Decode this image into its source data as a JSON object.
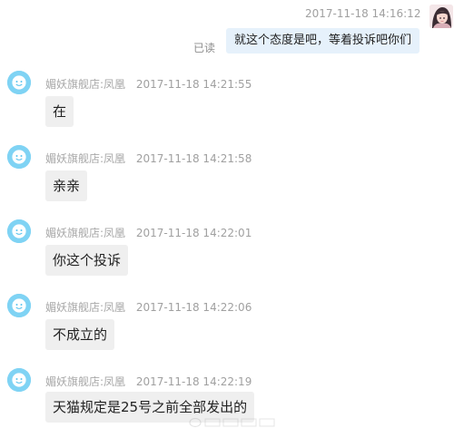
{
  "self_message": {
    "timestamp": "2017-11-18 14:16:12",
    "read_status": "已读",
    "text": "就这个态度是吧，等着投诉吧你们"
  },
  "messages": [
    {
      "sender": "媚妖旗舰店:凤凰",
      "timestamp": "2017-11-18 14:21:55",
      "text": "在"
    },
    {
      "sender": "媚妖旗舰店:凤凰",
      "timestamp": "2017-11-18 14:21:58",
      "text": "亲亲"
    },
    {
      "sender": "媚妖旗舰店:凤凰",
      "timestamp": "2017-11-18 14:22:01",
      "text": "你这个投诉"
    },
    {
      "sender": "媚妖旗舰店:凤凰",
      "timestamp": "2017-11-18 14:22:06",
      "text": "不成立的"
    },
    {
      "sender": "媚妖旗舰店:凤凰",
      "timestamp": "2017-11-18 14:22:19",
      "text": "天猫规定是25号之前全部发出的"
    }
  ],
  "colors": {
    "agent_avatar": "#7fd3f4",
    "agent_bubble": "#efefef",
    "self_bubble": "#e6f1fb"
  },
  "icons": {
    "agent_avatar": "customer-service-avatar-icon",
    "self_avatar": "user-avatar-icon"
  }
}
